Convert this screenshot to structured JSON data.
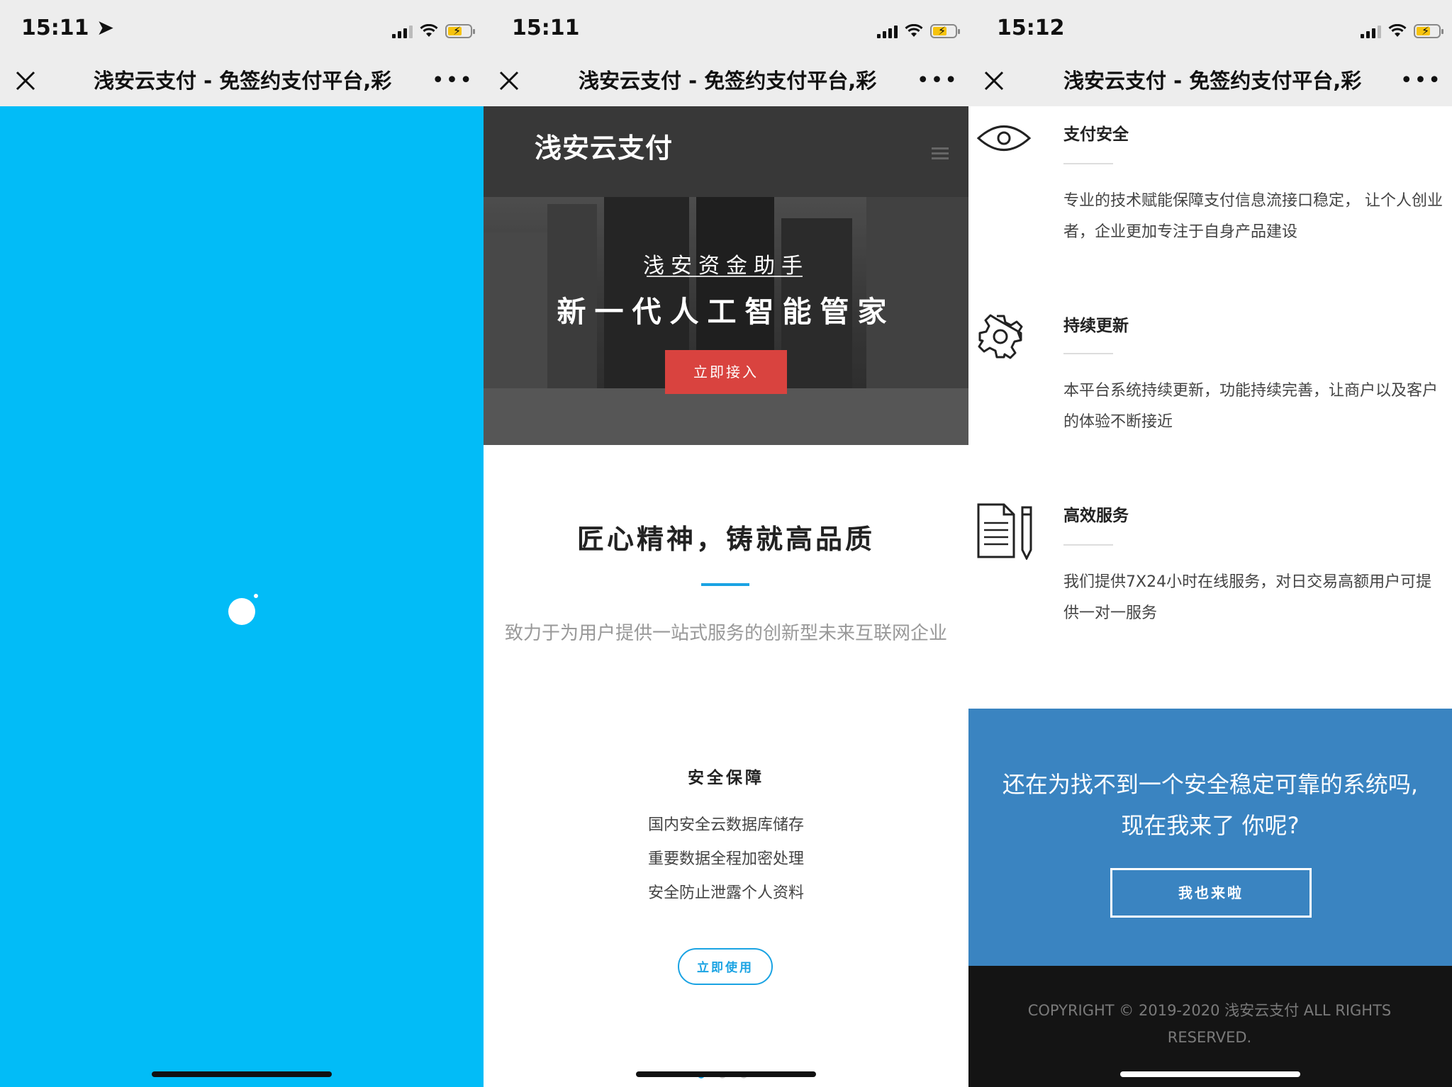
{
  "phone1": {
    "status": {
      "time": "15:11"
    },
    "nav": {
      "title": "浅安云支付 - 免签约支付平台,彩"
    },
    "colors": {
      "bg": "#02bcf7"
    }
  },
  "phone2": {
    "status": {
      "time": "15:11"
    },
    "nav": {
      "title": "浅安云支付 - 免签约支付平台,彩"
    },
    "header": {
      "logo": "浅安云支付"
    },
    "hero": {
      "subtitle": "浅安资金助手",
      "title": "新一代人工智能管家",
      "button": "立即接入"
    },
    "section": {
      "title": "匠心精神，铸就高品质",
      "description": "致力于为用户提供一站式服务的创新型未来互联网企业"
    },
    "feature": {
      "title": "安全保障",
      "lines": [
        "国内安全云数据库储存",
        "重要数据全程加密处理",
        "安全防止泄露个人资料"
      ],
      "button": "立即使用"
    }
  },
  "phone3": {
    "status": {
      "time": "15:12"
    },
    "nav": {
      "title": "浅安云支付 - 免签约支付平台,彩"
    },
    "features": [
      {
        "icon": "eye-icon",
        "title": "支付安全",
        "desc": "专业的技术赋能保障支付信息流接口稳定， 让个人创业者，企业更加专注于自身产品建设"
      },
      {
        "icon": "gear-icon",
        "title": "持续更新",
        "desc": "本平台系统持续更新，功能持续完善，让商户以及客户的体验不断接近"
      },
      {
        "icon": "document-pen-icon",
        "title": "高效服务",
        "desc": "我们提供7X24小时在线服务，对日交易高额用户可提供一对一服务"
      }
    ],
    "cta": {
      "line1": "还在为找不到一个安全稳定可靠的系统吗,",
      "line2": "现在我来了 你呢?",
      "button": "我也来啦"
    },
    "footer": {
      "line1": "COPYRIGHT © 2019-2020 浅安云支付 ALL RIGHTS",
      "line2": "RESERVED."
    }
  },
  "colors": {
    "accent": "#1aa3e3",
    "hero_button": "#d9433f",
    "cta_bg": "#3a84c1",
    "header_bg": "#383838"
  }
}
